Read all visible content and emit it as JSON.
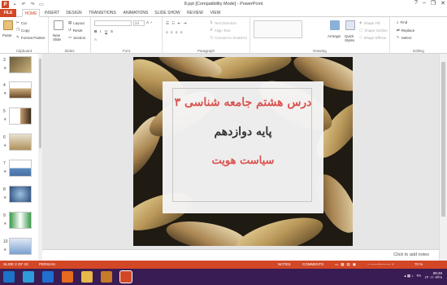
{
  "window": {
    "title": "8.ppt [Compatibility Mode] - PowerPoint",
    "controls": [
      "?",
      "–",
      "❐",
      "✕"
    ]
  },
  "tabs": [
    {
      "label": "FILE",
      "name": "tab-file"
    },
    {
      "label": "HOME",
      "name": "tab-home"
    },
    {
      "label": "INSERT",
      "name": "tab-insert"
    },
    {
      "label": "DESIGN",
      "name": "tab-design"
    },
    {
      "label": "TRANSITIONS",
      "name": "tab-transitions"
    },
    {
      "label": "ANIMATIONS",
      "name": "tab-animations"
    },
    {
      "label": "SLIDE SHOW",
      "name": "tab-slide-show"
    },
    {
      "label": "REVIEW",
      "name": "tab-review"
    },
    {
      "label": "VIEW",
      "name": "tab-view"
    }
  ],
  "ribbon": {
    "clipboard": {
      "paste": "Paste",
      "cut": "Cut",
      "copy": "Copy",
      "format_painter": "Format Painter",
      "label": "Clipboard"
    },
    "slides": {
      "new_slide": "New Slide",
      "layout": "Layout",
      "reset": "Reset",
      "section": "Section",
      "label": "Slides"
    },
    "font": {
      "font_name": "",
      "font_size": "24",
      "label": "Font"
    },
    "paragraph": {
      "text_direction": "Text Direction",
      "align_text": "Align Text",
      "smartart": "Convert to SmartArt",
      "label": "Paragraph"
    },
    "drawing": {
      "arrange": "Arrange",
      "quick_styles": "Quick Styles",
      "shape_fill": "Shape Fill",
      "shape_outline": "Shape Outline",
      "shape_effects": "Shape Effects",
      "label": "Drawing"
    },
    "editing": {
      "find": "Find",
      "replace": "Replace",
      "select": "Select",
      "label": "Editing"
    }
  },
  "thumbnails": [
    {
      "num": "3"
    },
    {
      "num": "4"
    },
    {
      "num": "5"
    },
    {
      "num": "6"
    },
    {
      "num": "7"
    },
    {
      "num": "8"
    },
    {
      "num": "9"
    },
    {
      "num": "10"
    }
  ],
  "slide": {
    "line1": "درس هشتم جامعه شناسی ۳",
    "line2": "پایه دوازدهم",
    "line3": "سیاست هویت"
  },
  "notes_placeholder": "Click to add notes",
  "status": {
    "slide_info": "SLIDE 2 OF 23",
    "language": "PERSIAN",
    "notes": "NOTES",
    "comments": "COMMENTS",
    "zoom": "70 %"
  },
  "tray": {
    "time": "08:49",
    "date": "۱۴۰۱/۰۷/۲۸",
    "lang": "FA"
  },
  "colors": {
    "accent": "#d24726",
    "taskbar": "#3a1c54",
    "slide_text": "#d9534f"
  }
}
